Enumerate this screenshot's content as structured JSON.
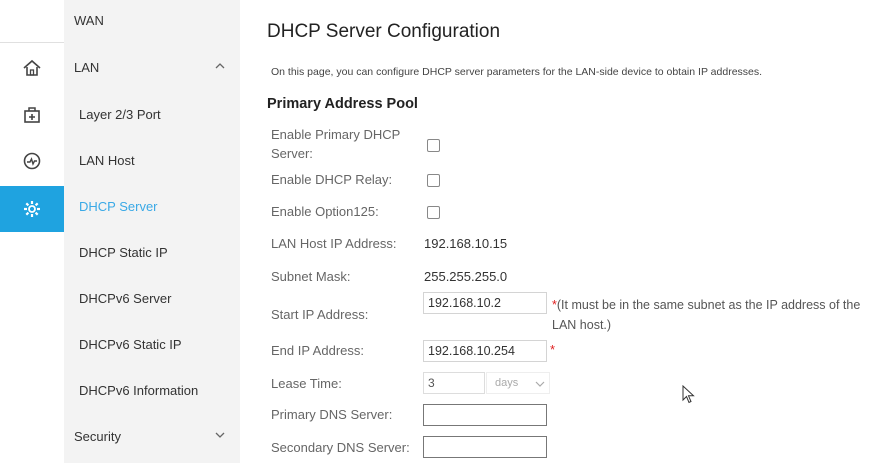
{
  "sidebar": {
    "icons": [
      "home-icon",
      "toolbox-icon",
      "diagnostics-icon",
      "settings-icon"
    ],
    "items": [
      {
        "label": "WAN",
        "type": "group"
      },
      {
        "label": "LAN",
        "type": "group",
        "expanded": true
      },
      {
        "label": "Layer 2/3 Port",
        "type": "sub"
      },
      {
        "label": "LAN Host",
        "type": "sub"
      },
      {
        "label": "DHCP Server",
        "type": "sub",
        "active": true
      },
      {
        "label": "DHCP Static IP",
        "type": "sub"
      },
      {
        "label": "DHCPv6 Server",
        "type": "sub"
      },
      {
        "label": "DHCPv6 Static IP",
        "type": "sub"
      },
      {
        "label": "DHCPv6 Information",
        "type": "sub"
      },
      {
        "label": "Security",
        "type": "group",
        "expanded": false
      }
    ]
  },
  "main": {
    "title": "DHCP Server Configuration",
    "description": "On this page, you can configure DHCP server parameters for the LAN-side device to obtain IP addresses.",
    "section_title": "Primary Address Pool",
    "enable_primary": {
      "label_line1": "Enable Primary DHCP",
      "label_line2": "Server:",
      "checked": false
    },
    "enable_relay": {
      "label": "Enable DHCP Relay:",
      "checked": false
    },
    "enable_option125": {
      "label": "Enable Option125:",
      "checked": false
    },
    "lan_host_ip": {
      "label": "LAN Host IP Address:",
      "value": "192.168.10.15"
    },
    "subnet_mask": {
      "label": "Subnet Mask:",
      "value": "255.255.255.0"
    },
    "start_ip": {
      "label": "Start IP Address:",
      "value": "192.168.10.2",
      "required": "*",
      "note": "(It must be in the same subnet as the IP address of the LAN host.)"
    },
    "end_ip": {
      "label": "End IP Address:",
      "value": "192.168.10.254",
      "required": "*"
    },
    "lease_time": {
      "label": "Lease Time:",
      "value": "3",
      "unit": "days"
    },
    "primary_dns": {
      "label": "Primary DNS Server:",
      "value": ""
    },
    "secondary_dns": {
      "label": "Secondary DNS Server:",
      "value": ""
    }
  },
  "colors": {
    "accent": "#1fa3e0",
    "active_text": "#3aa9e6",
    "required": "#e02020"
  }
}
